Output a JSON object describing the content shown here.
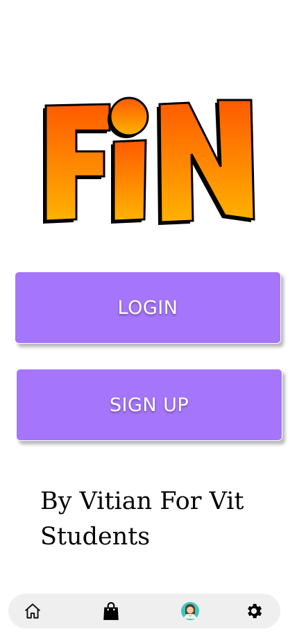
{
  "logo": {
    "text": "FiN",
    "gradient_top": "#ff5a00",
    "gradient_bottom": "#ffb300",
    "outline": "#000000"
  },
  "buttons": {
    "login_label": "LOGIN",
    "signup_label": "SIGN UP",
    "color": "#a575fb"
  },
  "tagline": "By Vitian For Vit Students",
  "bottom_nav": {
    "items": [
      {
        "icon": "home-icon"
      },
      {
        "icon": "shopping-bag-icon"
      },
      {
        "icon": "profile-avatar-icon"
      },
      {
        "icon": "gear-icon"
      }
    ]
  }
}
